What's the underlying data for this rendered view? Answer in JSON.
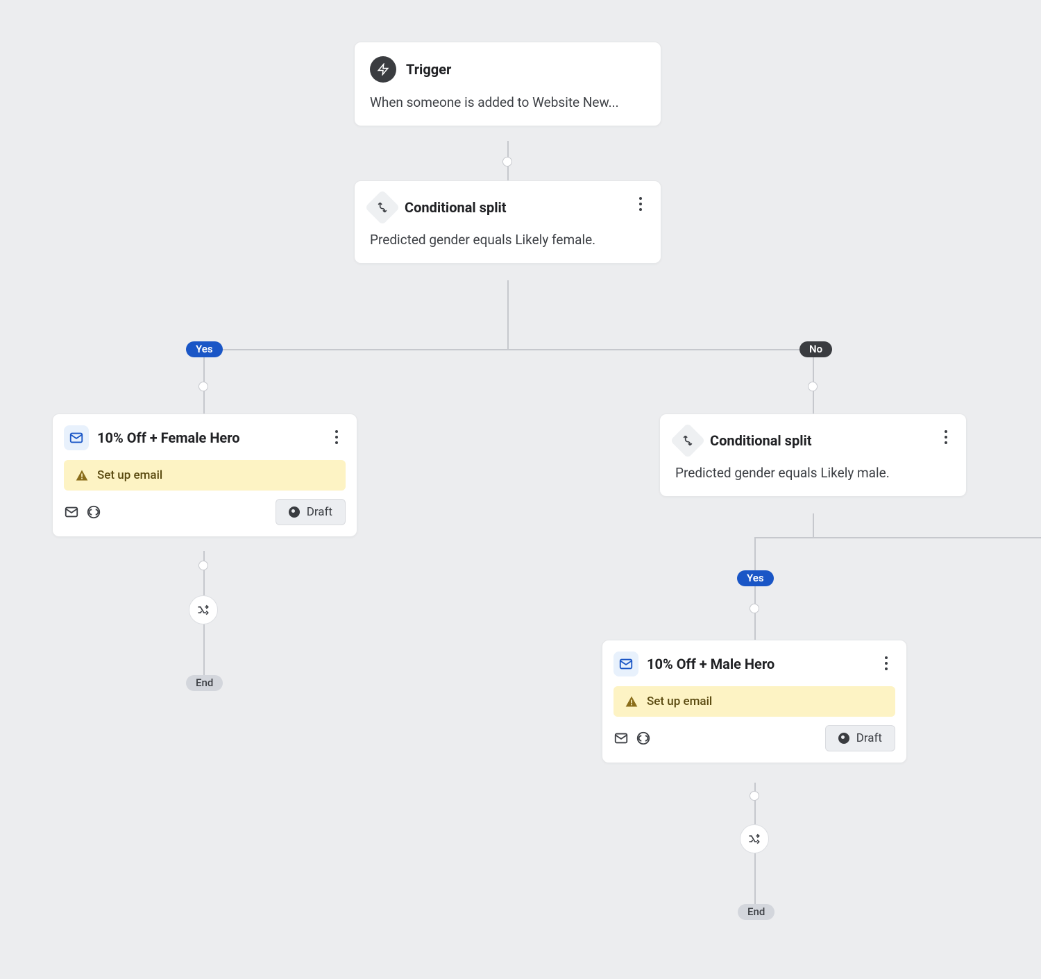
{
  "trigger": {
    "title": "Trigger",
    "description": "When someone is added to Website New..."
  },
  "split1": {
    "title": "Conditional split",
    "description": "Predicted gender equals Likely female."
  },
  "split2": {
    "title": "Conditional split",
    "description": "Predicted gender equals Likely male."
  },
  "emailFemale": {
    "title": "10% Off + Female Hero",
    "warning": "Set up email",
    "status": "Draft"
  },
  "emailMale": {
    "title": "10% Off + Male Hero",
    "warning": "Set up email",
    "status": "Draft"
  },
  "labels": {
    "yes": "Yes",
    "no": "No",
    "end": "End"
  }
}
